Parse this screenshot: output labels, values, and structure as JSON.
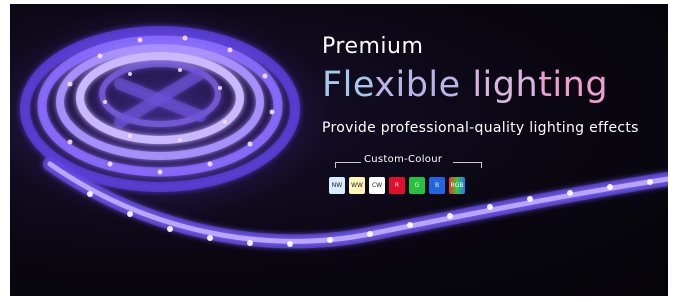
{
  "banner": {
    "premium": "Premium",
    "headline_parts": [
      "Fle",
      "xible ",
      "ligh",
      "ting"
    ],
    "tagline": "Provide professional-quality lighting effects",
    "custom_colour_label": "Custom-Colour",
    "swatches": [
      {
        "label": "NW",
        "color": "#d8ecff"
      },
      {
        "label": "WW",
        "color": "#fff6b8"
      },
      {
        "label": "CW",
        "color": "#ffffff"
      },
      {
        "label": "R",
        "color": "#e0102a"
      },
      {
        "label": "G",
        "color": "#28c040"
      },
      {
        "label": "B",
        "color": "#1f66e0"
      },
      {
        "label": "RGB",
        "color": "gradient"
      }
    ],
    "headline_colors": [
      "#a8c8e8",
      "#b9b6e6",
      "#d9b6e0",
      "#ee9fd0"
    ],
    "strip_glow_color": "#9a7cff"
  }
}
